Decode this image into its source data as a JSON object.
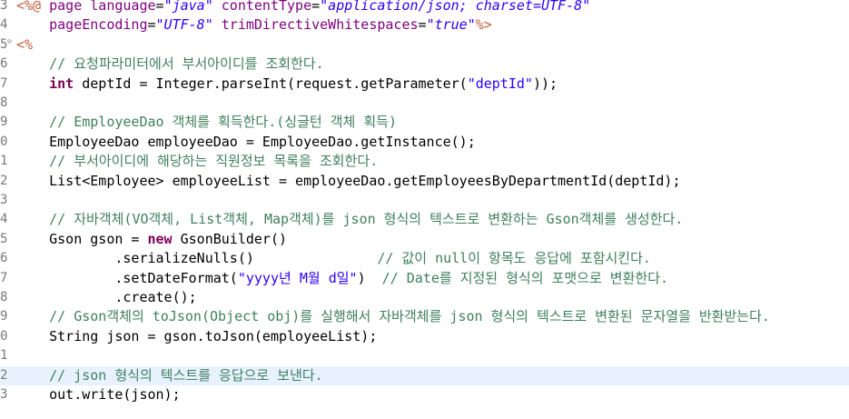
{
  "editor": {
    "lines": [
      {
        "num": "3",
        "fold": "",
        "current": false,
        "tokens": [
          {
            "t": "jsp",
            "v": "<%@"
          },
          {
            "t": "plain",
            "v": " "
          },
          {
            "t": "attr",
            "v": "page"
          },
          {
            "t": "plain",
            "v": " "
          },
          {
            "t": "attr",
            "v": "language"
          },
          {
            "t": "plain",
            "v": "="
          },
          {
            "t": "str",
            "v": "\"java\""
          },
          {
            "t": "plain",
            "v": " "
          },
          {
            "t": "attr",
            "v": "contentType"
          },
          {
            "t": "plain",
            "v": "="
          },
          {
            "t": "str",
            "v": "\"application/json; charset=UTF-8\""
          }
        ]
      },
      {
        "num": "4",
        "fold": "",
        "current": false,
        "tokens": [
          {
            "t": "plain",
            "v": "    "
          },
          {
            "t": "attr",
            "v": "pageEncoding"
          },
          {
            "t": "plain",
            "v": "="
          },
          {
            "t": "str",
            "v": "\"UTF-8\""
          },
          {
            "t": "plain",
            "v": " "
          },
          {
            "t": "attr",
            "v": "trimDirectiveWhitespaces"
          },
          {
            "t": "plain",
            "v": "="
          },
          {
            "t": "str",
            "v": "\"true\""
          },
          {
            "t": "jsp",
            "v": "%>"
          }
        ]
      },
      {
        "num": "5",
        "fold": "⊖",
        "current": false,
        "tokens": [
          {
            "t": "jsp",
            "v": "<%"
          }
        ]
      },
      {
        "num": "6",
        "fold": "",
        "current": false,
        "tokens": [
          {
            "t": "plain",
            "v": "    "
          },
          {
            "t": "cmt",
            "v": "// 요청파라미터에서 부서아이디를 조회한다."
          }
        ]
      },
      {
        "num": "7",
        "fold": "",
        "current": false,
        "tokens": [
          {
            "t": "plain",
            "v": "    "
          },
          {
            "t": "kw",
            "v": "int"
          },
          {
            "t": "plain",
            "v": " deptId = Integer.parseInt(request.getParameter("
          },
          {
            "t": "strn",
            "v": "\"deptId\""
          },
          {
            "t": "plain",
            "v": "));"
          }
        ]
      },
      {
        "num": "8",
        "fold": "",
        "current": false,
        "tokens": []
      },
      {
        "num": "9",
        "fold": "",
        "current": false,
        "tokens": [
          {
            "t": "plain",
            "v": "    "
          },
          {
            "t": "cmt",
            "v": "// EmployeeDao 객체를 획득한다.(싱글턴 객체 획득)"
          }
        ]
      },
      {
        "num": "0",
        "fold": "",
        "current": false,
        "tokens": [
          {
            "t": "plain",
            "v": "    EmployeeDao employeeDao = EmployeeDao.getInstance();"
          }
        ]
      },
      {
        "num": "1",
        "fold": "",
        "current": false,
        "tokens": [
          {
            "t": "plain",
            "v": "    "
          },
          {
            "t": "cmt",
            "v": "// 부서아이디에 해당하는 직원정보 목록을 조회한다."
          }
        ]
      },
      {
        "num": "2",
        "fold": "",
        "current": false,
        "tokens": [
          {
            "t": "plain",
            "v": "    List<Employee> employeeList = employeeDao.getEmployeesByDepartmentId(deptId);"
          }
        ]
      },
      {
        "num": "3",
        "fold": "",
        "current": false,
        "tokens": []
      },
      {
        "num": "4",
        "fold": "",
        "current": false,
        "tokens": [
          {
            "t": "plain",
            "v": "    "
          },
          {
            "t": "cmt",
            "v": "// 자바객체(VO객체, List객체, Map객체)를 json 형식의 텍스트로 변환하는 Gson객체를 생성한다."
          }
        ]
      },
      {
        "num": "5",
        "fold": "",
        "current": false,
        "tokens": [
          {
            "t": "plain",
            "v": "    Gson gson = "
          },
          {
            "t": "kw",
            "v": "new"
          },
          {
            "t": "plain",
            "v": " GsonBuilder()"
          }
        ]
      },
      {
        "num": "6",
        "fold": "",
        "current": false,
        "tokens": [
          {
            "t": "plain",
            "v": "            .serializeNulls()               "
          },
          {
            "t": "cmt",
            "v": "// 값이 null이 항목도 응답에 포함시킨다."
          }
        ]
      },
      {
        "num": "7",
        "fold": "",
        "current": false,
        "tokens": [
          {
            "t": "plain",
            "v": "            .setDateFormat("
          },
          {
            "t": "strn",
            "v": "\"yyyy년 M월 d일\""
          },
          {
            "t": "plain",
            "v": ")  "
          },
          {
            "t": "cmt",
            "v": "// Date를 지정된 형식의 포맷으로 변환한다."
          }
        ]
      },
      {
        "num": "8",
        "fold": "",
        "current": false,
        "tokens": [
          {
            "t": "plain",
            "v": "            .create();"
          }
        ]
      },
      {
        "num": "9",
        "fold": "",
        "current": false,
        "tokens": [
          {
            "t": "plain",
            "v": "    "
          },
          {
            "t": "cmt",
            "v": "// Gson객체의 toJson(Object obj)를 실행해서 자바객체를 json 형식의 텍스트로 변환된 문자열을 반환받는다."
          }
        ]
      },
      {
        "num": "0",
        "fold": "",
        "current": false,
        "tokens": [
          {
            "t": "plain",
            "v": "    String json = gson.toJson(employeeList);"
          }
        ]
      },
      {
        "num": "1",
        "fold": "",
        "current": false,
        "tokens": []
      },
      {
        "num": "2",
        "fold": "",
        "current": true,
        "tokens": [
          {
            "t": "plain",
            "v": "    "
          },
          {
            "t": "cmt",
            "v": "// json 형식의 텍스트를 응답으로 보낸다."
          }
        ]
      },
      {
        "num": "3",
        "fold": "",
        "current": false,
        "tokens": [
          {
            "t": "plain",
            "v": "    out.write(json);"
          }
        ]
      }
    ]
  }
}
